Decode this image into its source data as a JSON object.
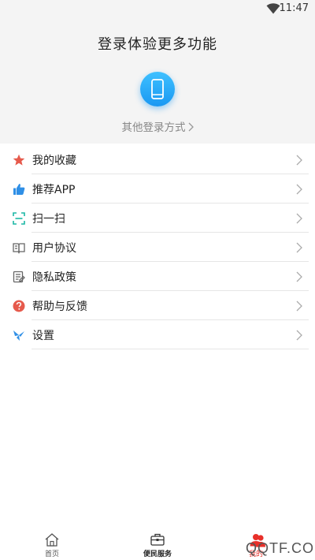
{
  "status_bar": {
    "time": "11:47",
    "wifi_icon": "wifi-icon"
  },
  "login": {
    "title": "登录体验更多功能",
    "phone_icon": "phone-icon",
    "other_methods": "其他登录方式"
  },
  "menu": {
    "items": [
      {
        "label": "我的收藏",
        "icon": "star-icon",
        "color": "#e65a4c"
      },
      {
        "label": "推荐APP",
        "icon": "thumbs-up-icon",
        "color": "#2f8fe6"
      },
      {
        "label": "扫一扫",
        "icon": "scan-icon",
        "color": "#1bb7a5"
      },
      {
        "label": "用户协议",
        "icon": "book-icon",
        "color": "#666666"
      },
      {
        "label": "隐私政策",
        "icon": "document-icon",
        "color": "#666666"
      },
      {
        "label": "帮助与反馈",
        "icon": "question-icon",
        "color": "#e65a4c"
      },
      {
        "label": "设置",
        "icon": "settings-pinwheel-icon",
        "color": "#2f8fe6"
      }
    ]
  },
  "tab_bar": {
    "tabs": [
      {
        "label": "首页",
        "icon": "home-icon"
      },
      {
        "label": "便民服务",
        "icon": "briefcase-icon"
      },
      {
        "label": "我的",
        "icon": "person-icon"
      }
    ],
    "active_color": "#e8302a"
  },
  "watermark": {
    "text": "QQTF.COM"
  },
  "colors": {
    "accent": "#1a98f2",
    "panel_bg": "#f4f4f4",
    "divider": "#e6e6e6"
  }
}
